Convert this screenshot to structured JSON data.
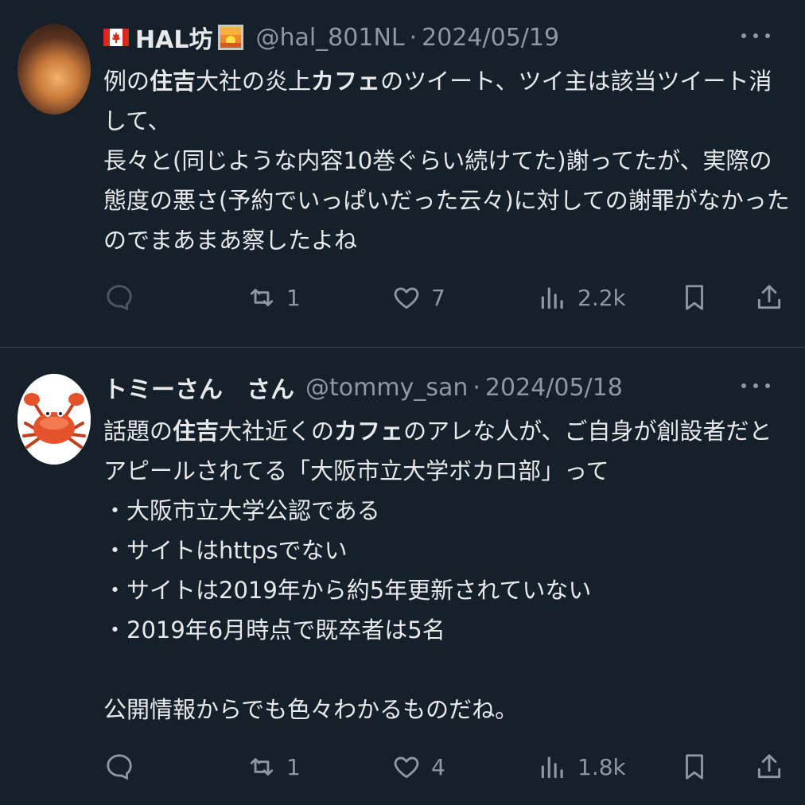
{
  "colors": {
    "background": "#15202b",
    "text_primary": "#e7e9ea",
    "text_secondary": "#8b98a5",
    "divider": "#38444d"
  },
  "tweets": [
    {
      "display_name": "HAL坊",
      "name_icons": [
        "canada-flag-icon",
        "sunrise-emoji-icon"
      ],
      "handle": "@hal_801NL",
      "separator": "·",
      "date": "2024/05/19",
      "body_lines": [
        [
          {
            "t": "例の"
          },
          {
            "t": "住吉",
            "b": true
          },
          {
            "t": "大社の炎上"
          },
          {
            "t": "カフェ",
            "b": true
          },
          {
            "t": "のツイート、ツイ主は該当ツイート消"
          }
        ],
        [
          {
            "t": "して、"
          }
        ],
        [
          {
            "t": "長々と(同じような内容10巻ぐらい続けてた)謝ってたが、実際の"
          }
        ],
        [
          {
            "t": "態度の悪さ(予約でいっぱいだった云々)に対しての謝罪がなかった"
          }
        ],
        [
          {
            "t": "のでまあまあ察したよね"
          }
        ]
      ],
      "actions": {
        "reply_count": "",
        "retweet_count": "1",
        "like_count": "7",
        "view_count": "2.2k"
      }
    },
    {
      "display_name": "トミーさん　さん",
      "name_icons": [],
      "handle": "@tommy_san",
      "separator": "·",
      "date": "2024/05/18",
      "body_lines": [
        [
          {
            "t": "話題の"
          },
          {
            "t": "住吉",
            "b": true
          },
          {
            "t": "大社近くの"
          },
          {
            "t": "カフェ",
            "b": true
          },
          {
            "t": "のアレな人が、ご自身が創設者だと"
          }
        ],
        [
          {
            "t": "アピールされてる「大阪市立大学ボカロ部」って"
          }
        ],
        [
          {
            "t": "・大阪市立大学公認である"
          }
        ],
        [
          {
            "t": "・サイトはhttpsでない"
          }
        ],
        [
          {
            "t": "・サイトは2019年から約5年更新されていない"
          }
        ],
        [
          {
            "t": "・2019年6月時点で既卒者は5名"
          }
        ],
        [],
        [
          {
            "t": "公開情報からでも色々わかるものだね。"
          }
        ]
      ],
      "actions": {
        "reply_count": "",
        "retweet_count": "1",
        "like_count": "4",
        "view_count": "1.8k"
      }
    }
  ]
}
